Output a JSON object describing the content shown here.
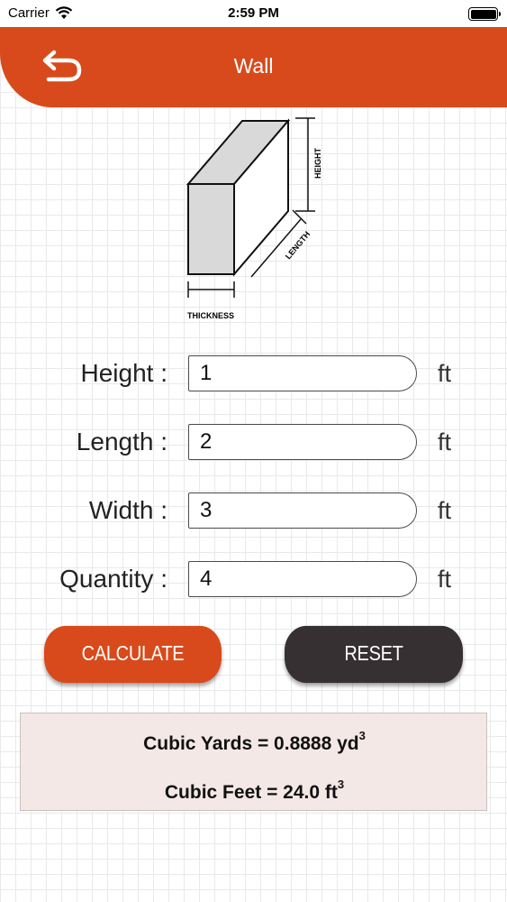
{
  "status_bar": {
    "carrier": "Carrier",
    "time": "2:59 PM"
  },
  "header": {
    "title": "Wall",
    "back_icon": "back-arrow-icon",
    "color": "#d84a1b"
  },
  "diagram": {
    "height_label": "HEIGHT",
    "length_label": "LENGTH",
    "thickness_label": "THICKNESS"
  },
  "form": {
    "rows": [
      {
        "label": "Height :",
        "value": "1",
        "unit": "ft"
      },
      {
        "label": "Length :",
        "value": "2",
        "unit": "ft"
      },
      {
        "label": "Width :",
        "value": "3",
        "unit": "ft"
      },
      {
        "label": "Quantity :",
        "value": "4",
        "unit": "ft"
      }
    ]
  },
  "buttons": {
    "calculate": "CALCULATE",
    "reset": "RESET",
    "calculate_color": "#d84a1b",
    "reset_color": "#363032"
  },
  "results": {
    "yards_text": "Cubic Yards = 0.8888 yd",
    "yards_exp": "3",
    "feet_text": "Cubic Feet = 24.0 ft",
    "feet_exp": "3"
  }
}
